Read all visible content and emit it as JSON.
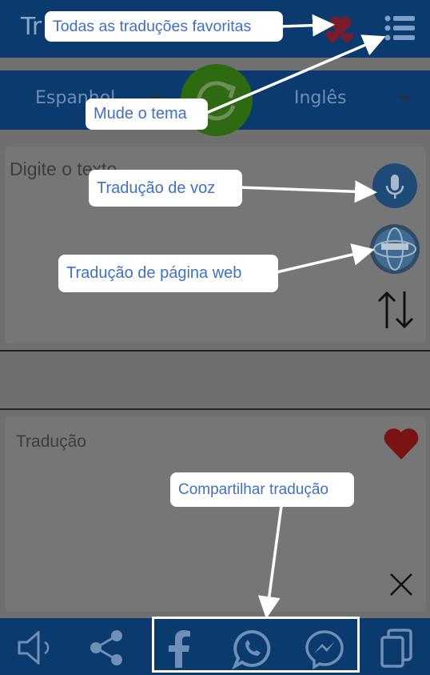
{
  "app": {
    "title_visible": "Tr"
  },
  "languages": {
    "source": "Espanhol",
    "target": "Inglês"
  },
  "input": {
    "placeholder": "Digite o texto"
  },
  "output": {
    "placeholder": "Tradução"
  },
  "callouts": {
    "favorites": "Todas as traduções favoritas",
    "theme": "Mude o tema",
    "voice": "Tradução de voz",
    "web": "Tradução de página web",
    "share": "Compartilhar tradução"
  },
  "icons": {
    "favorites": "hearts-icon",
    "menu": "list-menu-icon",
    "swap": "refresh-icon",
    "mic": "microphone-icon",
    "web": "globe-icon",
    "direction": "swap-vertical-icon",
    "favorite": "heart-icon",
    "clear": "close-icon",
    "speaker": "speaker-icon",
    "share": "share-icon",
    "facebook": "facebook-icon",
    "whatsapp": "whatsapp-icon",
    "messenger": "messenger-icon",
    "copy": "copy-icon"
  },
  "colors": {
    "primary": "#0b3a6e",
    "accent": "#3f6fd0",
    "green": "#2e6a12",
    "heart": "#7a1414"
  }
}
